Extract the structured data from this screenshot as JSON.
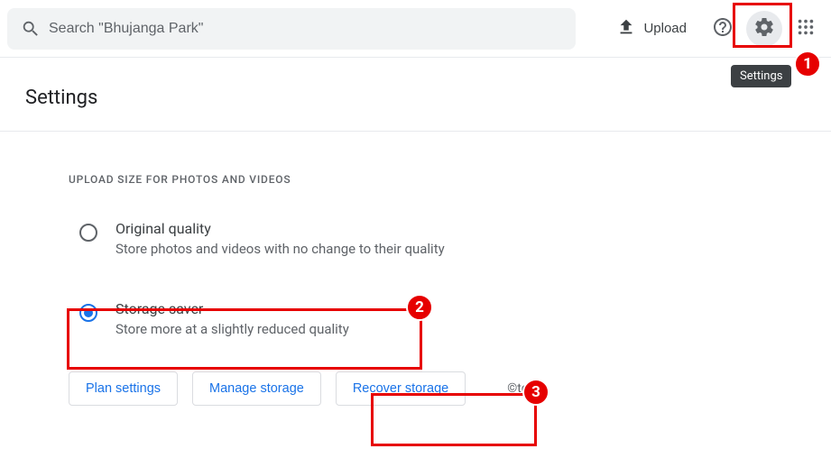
{
  "header": {
    "search_placeholder": "Search \"Bhujanga Park\"",
    "upload_label": "Upload"
  },
  "tooltip": {
    "settings_label": "Settings"
  },
  "page": {
    "title": "Settings"
  },
  "section": {
    "heading": "Upload size for photos and videos",
    "options": {
      "original": {
        "title": "Original quality",
        "desc": "Store photos and videos with no change to their quality"
      },
      "saver": {
        "title": "Storage saver",
        "desc": "Store more at a slightly reduced quality"
      }
    },
    "buttons": {
      "plan": "Plan settings",
      "manage": "Manage storage",
      "recover": "Recover storage"
    }
  },
  "footer": {
    "copyright": "©tgp"
  },
  "callouts": {
    "one": "1",
    "two": "2",
    "three": "3"
  }
}
